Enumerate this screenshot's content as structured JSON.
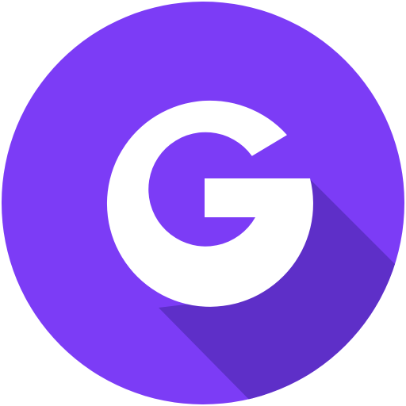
{
  "logo": {
    "letter": "G",
    "icon": "letter-g-logo-icon",
    "colors": {
      "background": "#ffffff",
      "circle": "#7c3cf6",
      "long_shadow": "#5e2fc8",
      "letter": "#ffffff"
    }
  }
}
